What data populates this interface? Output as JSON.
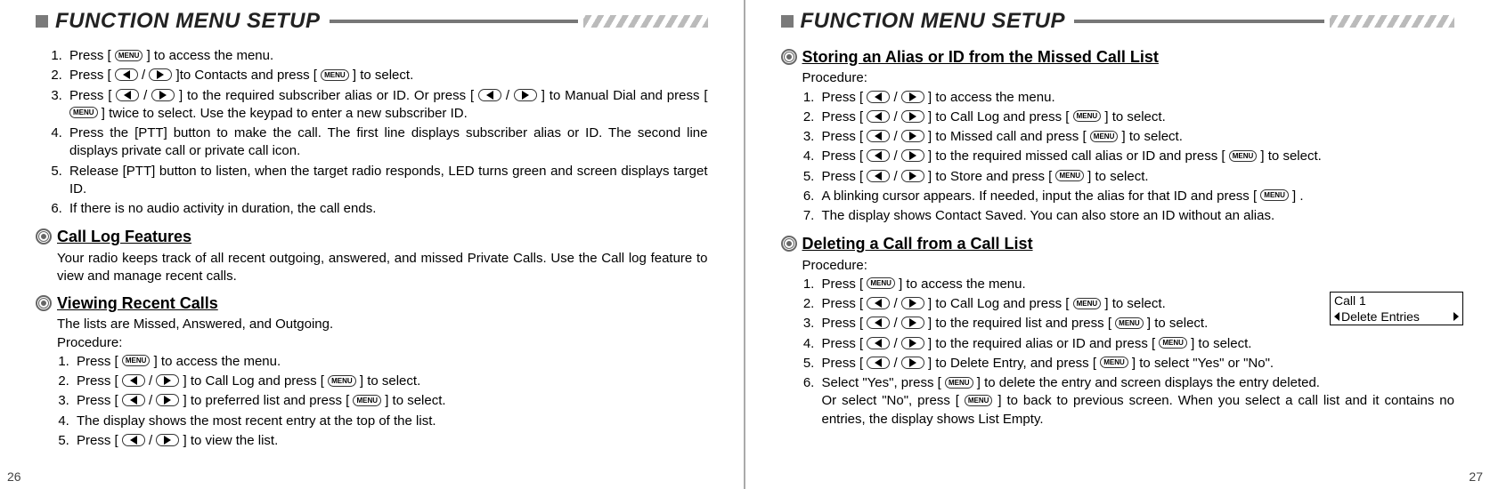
{
  "header_title": "FUNCTION MENU SETUP",
  "keys": {
    "menu": "MENU"
  },
  "left": {
    "page_num": "26",
    "top_list": [
      "Press [ {MENU} ] to access the menu.",
      "Press [ {LEFT} / {RIGHT} ]to Contacts and press [ {MENU} ] to select.",
      "Press [ {LEFT} / {RIGHT} ] to the required subscriber alias or ID. Or press [ {LEFT} / {RIGHT} ] to Manual Dial and press [ {MENU} ] twice to select. Use the keypad to enter a new subscriber ID.",
      "Press the [PTT] button to make the call. The first line displays subscriber alias or ID. The second line displays private call or private call icon.",
      "Release [PTT] button to listen, when the target radio responds, LED turns green and screen displays target ID.",
      "If there is no audio activity in duration, the call ends."
    ],
    "sec1_title": "Call Log Features",
    "sec1_body": "Your radio keeps track of all recent outgoing, answered, and missed Private Calls. Use the Call log feature to view and manage recent calls.",
    "sec2_title": "Viewing Recent Calls",
    "sec2_intro1": "The lists are Missed, Answered, and Outgoing.",
    "sec2_intro2": "Procedure:",
    "sec2_list": [
      "Press [ {MENU} ] to access the menu.",
      "Press  [ {LEFT} / {RIGHT} ]  to Call Log and press [ {MENU} ]  to select.",
      "Press  [ {LEFT} / {RIGHT} ]  to preferred list and press [ {MENU} ] to select.",
      "The display shows the most recent entry at the top of the list.",
      "Press [ {LEFT} / {RIGHT} ] to view the list."
    ]
  },
  "right": {
    "page_num": "27",
    "sec1_title": "Storing an Alias or ID from the Missed Call List",
    "sec1_intro": "Procedure:",
    "sec1_list": [
      "Press [ {LEFT} / {RIGHT} ] to access the menu.",
      "Press [ {LEFT} / {RIGHT} ] to Call Log and press [ {MENU} ] to select.",
      "Press [ {LEFT} / {RIGHT} ] to Missed call and press [ {MENU} ] to select.",
      "Press [ {LEFT} / {RIGHT} ] to the required missed call alias or ID and press [ {MENU} ] to select.",
      "Press [ {LEFT} / {RIGHT} ] to Store and press [ {MENU} ] to select.",
      "A blinking cursor appears. If needed, input the alias for that ID and press [ {MENU} ] .",
      "The display shows Contact Saved. You can also store an ID without an alias."
    ],
    "sec2_title": "Deleting a Call from a Call List",
    "sec2_intro": "Procedure:",
    "sec2_list": [
      "Press [ {MENU} ] to access the menu.",
      "Press [ {LEFT} / {RIGHT} ] to Call Log and press [ {MENU} ] to select.",
      " Press [ {LEFT} / {RIGHT} ] to the required list and press [ {MENU} ] to select.",
      "Press [ {LEFT} / {RIGHT} ] to the required alias or ID and press [ {MENU} ] to select.",
      "Press [ {LEFT} / {RIGHT} ] to Delete Entry, and press [ {MENU} ]  to select \"Yes\" or \"No\".",
      "Select \"Yes\", press [ {MENU} ] to  delete the entry and screen displays the entry deleted.\nOr select \"No\", press [ {MENU} ] to back to previous screen. When you select a call list and it contains no entries, the display shows List Empty."
    ],
    "display": {
      "line1": "Call 1",
      "line2": "Delete Entries"
    }
  }
}
